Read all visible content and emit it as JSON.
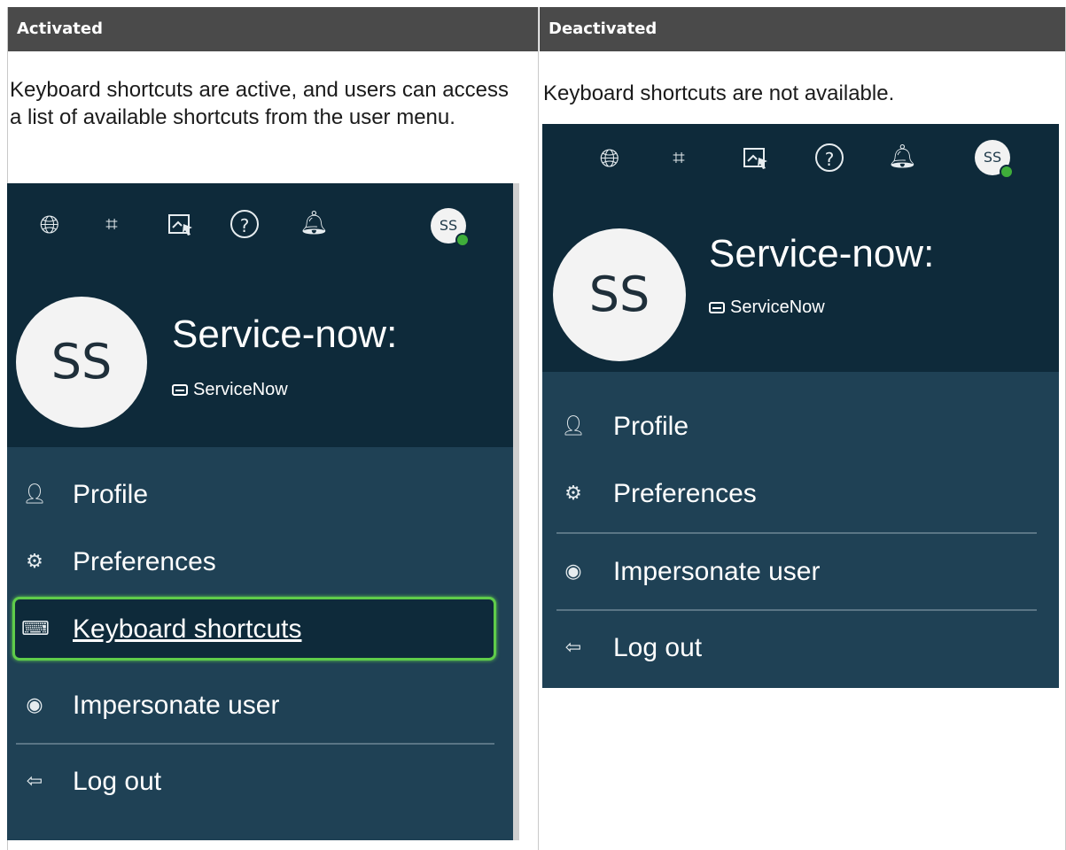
{
  "table": {
    "headers": [
      "Activated",
      "Deactivated"
    ],
    "activated_description": "Keyboard shortcuts are active, and users can access a list of available shortcuts from the user menu.",
    "deactivated_description": "Keyboard shortcuts are not available."
  },
  "menu": {
    "avatar_initials": "SS",
    "user_name": "Service-now:",
    "instance_name": "ServiceNow",
    "items_activated": [
      "Profile",
      "Preferences",
      "Keyboard shortcuts",
      "Impersonate user",
      "Log out"
    ],
    "items_deactivated": [
      "Profile",
      "Preferences",
      "Impersonate user",
      "Log out"
    ]
  },
  "toolbar_icons": [
    "globe-icon",
    "chat-icon",
    "screen-cursor-icon",
    "help-icon",
    "bell-icon"
  ],
  "colors": {
    "header_bg": "#4a4a4a",
    "nav_bg": "#0e2a3a",
    "menu_bg": "#1f4155",
    "focus_ring": "#5fcc4a",
    "status_dot": "#3fae3a"
  }
}
